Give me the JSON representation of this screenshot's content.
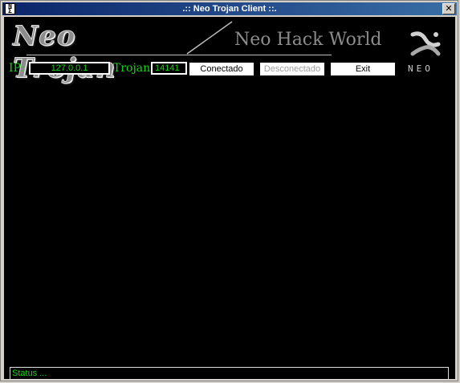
{
  "window": {
    "title": ".:: Neo Trojan Client ::.",
    "close_glyph": "✕",
    "icon_name": "neo-app-icon"
  },
  "header": {
    "logo_text": "Neo Trojan",
    "subtitle": "Neo Hack World",
    "brand_word": "NEO",
    "brand_icon": "neo-logo-icon"
  },
  "connection": {
    "ip_label": "IP:",
    "ip_value": "127.0.0.1",
    "trojan_label": "Trojan",
    "port_value": "14141",
    "connect_label": "Conectado",
    "disconnect_label": "Desconectado",
    "exit_label": "Exit"
  },
  "status": {
    "text": "Status ..."
  },
  "colors": {
    "accent_green": "#19d219",
    "background": "#000000",
    "title_bar": "#0a246a"
  }
}
